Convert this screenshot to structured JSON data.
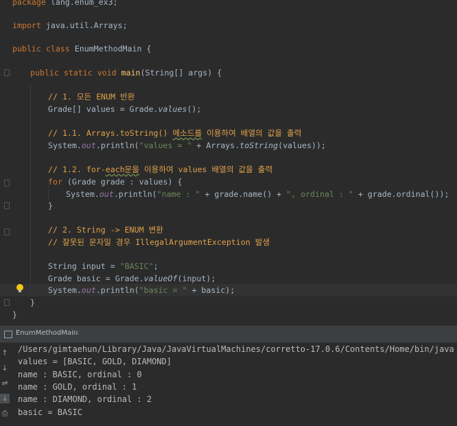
{
  "editor": {
    "lines": {
      "l0": {
        "kw": "package",
        "rest": " lang.enum_ex3;"
      },
      "l1": {
        "kw": "import",
        "rest": " java.util.Arrays;"
      },
      "l2": {
        "kw": "public class",
        "rest": " EnumMethodMain {"
      },
      "l3": {
        "kw": "public static void",
        "fn": " main",
        "rest": "(String[] args) {"
      },
      "l4": {
        "comment": "// 1. 모든 ENUM 반환"
      },
      "l5": {
        "a": "Grade[] values = Grade.",
        "it": "values",
        "b": "();"
      },
      "l6": {
        "c1": "// 1.1. Arrays.toString() ",
        "c2": "메소드를",
        "c3": " 이용하여 배열의 값을 출력"
      },
      "l7": {
        "a": "System.",
        "it": "out",
        "b": ".println(",
        "st": "\"values = \"",
        "c": " + Arrays.",
        "it2": "toString",
        "d": "(values));"
      },
      "l8": {
        "c1": "// 1.2. for-",
        "c2": "each문을",
        "c3": " 이용하여 values 배열의 값을 출력"
      },
      "l9": {
        "kw": "for",
        "rest": " (Grade grade : values) {"
      },
      "l10": {
        "a": "System.",
        "it": "out",
        "b": ".println(",
        "st1": "\"name : \"",
        "c": " + grade.name() + ",
        "st2": "\", ordinal : \"",
        "d": " + grade.ordinal());"
      },
      "l11": {
        "rest": "}"
      },
      "l12": {
        "comment": "// 2. String -> ENUM 변환"
      },
      "l13": {
        "comment": "// 잘못된 문자일 경우 IllegalArgumentException 발생"
      },
      "l14": {
        "a": "String input = ",
        "st": "\"BASIC\"",
        "b": ";"
      },
      "l15": {
        "a": "Grade basic = Grade.",
        "it": "valueOf",
        "b": "(input);"
      },
      "l16": {
        "a": "System.",
        "it": "out",
        "b": ".println(",
        "st": "\"basic = \"",
        "c": " + basic);"
      },
      "l17": {
        "rest": "}"
      },
      "l18": {
        "rest": "}"
      }
    }
  },
  "run_panel": {
    "tab_label": "EnumMethodMain",
    "tab_close": "×",
    "output": [
      "/Users/gimtaehun/Library/Java/JavaVirtualMachines/corretto-17.0.6/Contents/Home/bin/java",
      "values = [BASIC, GOLD, DIAMOND]",
      "name : BASIC, ordinal : 0",
      "name : GOLD, ordinal : 1",
      "name : DIAMOND, ordinal : 2",
      "basic = BASIC"
    ],
    "tools": [
      "↑",
      "↓",
      "⇌",
      "⤓",
      "⎙"
    ]
  },
  "colors": {
    "background": "#2b2b2b",
    "keyword": "#cc7832",
    "comment": "#e0a04a",
    "string": "#6a8759",
    "method": "#ffc66d",
    "field": "#9876aa"
  }
}
